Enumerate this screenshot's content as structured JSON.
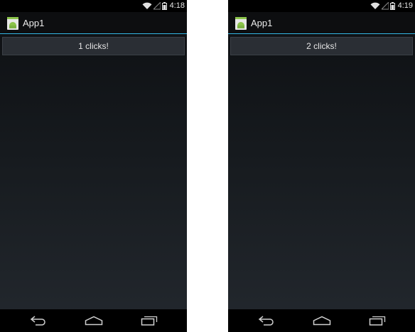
{
  "screens": [
    {
      "status": {
        "time": "4:18"
      },
      "action_bar": {
        "title": "App1"
      },
      "button": {
        "label": "1 clicks!"
      }
    },
    {
      "status": {
        "time": "4:19"
      },
      "action_bar": {
        "title": "App1"
      },
      "button": {
        "label": "2 clicks!"
      }
    }
  ],
  "icons": {
    "status": [
      "wifi-icon",
      "signal-icon",
      "battery-icon"
    ],
    "app": "android-app-icon",
    "navigation": [
      "back-icon",
      "home-icon",
      "recent-apps-icon"
    ]
  },
  "colors": {
    "accent": "#33b5e5",
    "button_bg": "#2a2e34",
    "app_icon_green": "#8bc34a"
  }
}
